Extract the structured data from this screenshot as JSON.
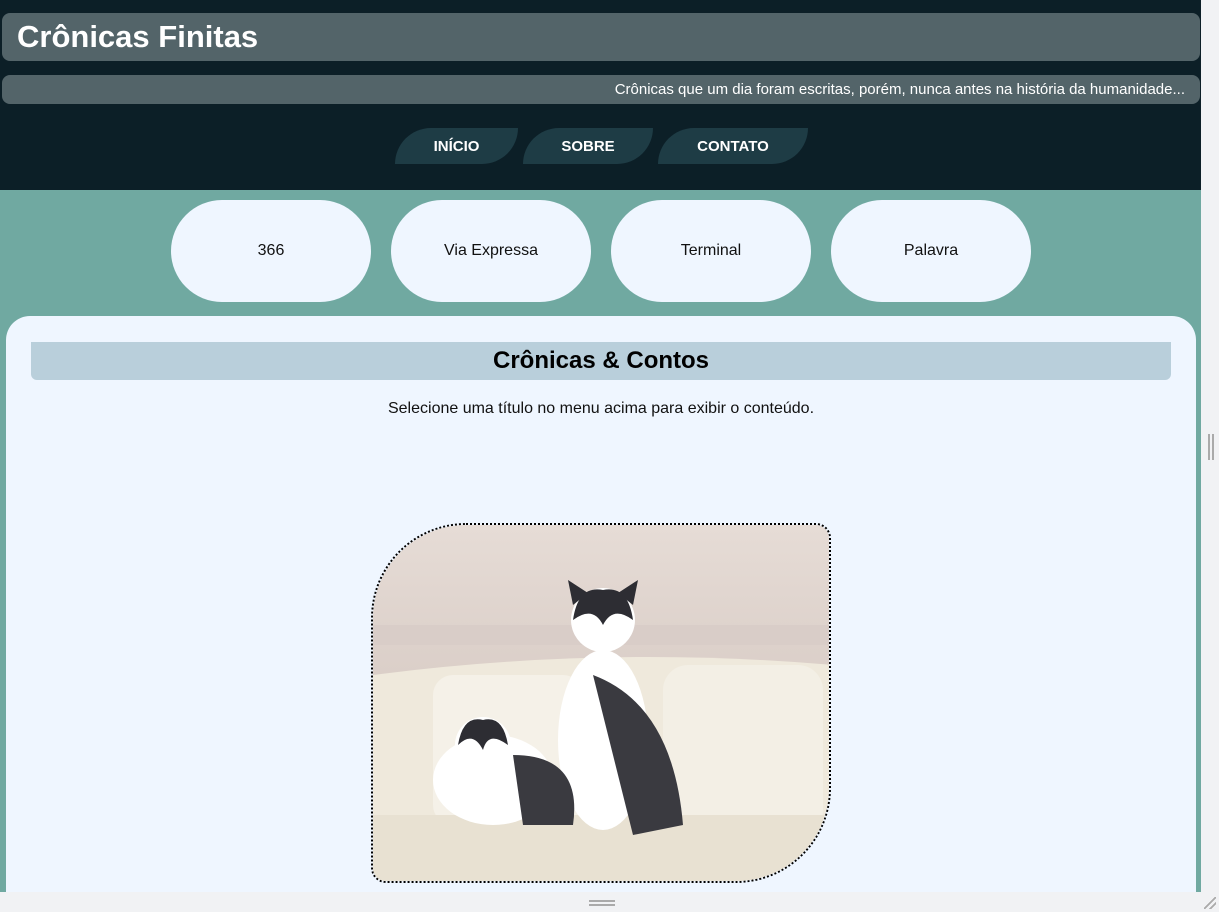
{
  "header": {
    "title": "Crônicas Finitas",
    "subtitle": "Crônicas que um dia foram escritas, porém, nunca antes na história da humanidade..."
  },
  "nav": [
    {
      "label": "INÍCIO"
    },
    {
      "label": "SOBRE"
    },
    {
      "label": "CONTATO"
    }
  ],
  "stories": [
    {
      "label": "366"
    },
    {
      "label": "Via Expressa"
    },
    {
      "label": "Terminal"
    },
    {
      "label": "Palavra"
    }
  ],
  "content": {
    "title": "Crônicas & Contos",
    "message": "Selecione uma título no menu acima para exibir o conteúdo."
  },
  "colors": {
    "header_bg": "#0c1f27",
    "title_bar": "#536469",
    "page_bg": "#70a9a1",
    "panel_bg": "#eff6ff",
    "content_title_bg": "#b9cfdb"
  }
}
